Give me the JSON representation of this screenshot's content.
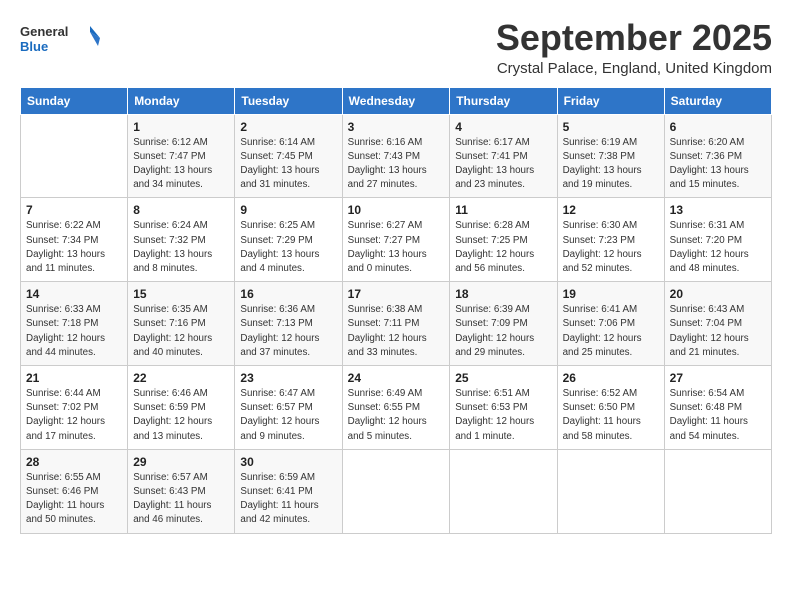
{
  "header": {
    "logo_general": "General",
    "logo_blue": "Blue",
    "month": "September 2025",
    "location": "Crystal Palace, England, United Kingdom"
  },
  "weekdays": [
    "Sunday",
    "Monday",
    "Tuesday",
    "Wednesday",
    "Thursday",
    "Friday",
    "Saturday"
  ],
  "weeks": [
    [
      {
        "day": "",
        "info": ""
      },
      {
        "day": "1",
        "info": "Sunrise: 6:12 AM\nSunset: 7:47 PM\nDaylight: 13 hours\nand 34 minutes."
      },
      {
        "day": "2",
        "info": "Sunrise: 6:14 AM\nSunset: 7:45 PM\nDaylight: 13 hours\nand 31 minutes."
      },
      {
        "day": "3",
        "info": "Sunrise: 6:16 AM\nSunset: 7:43 PM\nDaylight: 13 hours\nand 27 minutes."
      },
      {
        "day": "4",
        "info": "Sunrise: 6:17 AM\nSunset: 7:41 PM\nDaylight: 13 hours\nand 23 minutes."
      },
      {
        "day": "5",
        "info": "Sunrise: 6:19 AM\nSunset: 7:38 PM\nDaylight: 13 hours\nand 19 minutes."
      },
      {
        "day": "6",
        "info": "Sunrise: 6:20 AM\nSunset: 7:36 PM\nDaylight: 13 hours\nand 15 minutes."
      }
    ],
    [
      {
        "day": "7",
        "info": "Sunrise: 6:22 AM\nSunset: 7:34 PM\nDaylight: 13 hours\nand 11 minutes."
      },
      {
        "day": "8",
        "info": "Sunrise: 6:24 AM\nSunset: 7:32 PM\nDaylight: 13 hours\nand 8 minutes."
      },
      {
        "day": "9",
        "info": "Sunrise: 6:25 AM\nSunset: 7:29 PM\nDaylight: 13 hours\nand 4 minutes."
      },
      {
        "day": "10",
        "info": "Sunrise: 6:27 AM\nSunset: 7:27 PM\nDaylight: 13 hours\nand 0 minutes."
      },
      {
        "day": "11",
        "info": "Sunrise: 6:28 AM\nSunset: 7:25 PM\nDaylight: 12 hours\nand 56 minutes."
      },
      {
        "day": "12",
        "info": "Sunrise: 6:30 AM\nSunset: 7:23 PM\nDaylight: 12 hours\nand 52 minutes."
      },
      {
        "day": "13",
        "info": "Sunrise: 6:31 AM\nSunset: 7:20 PM\nDaylight: 12 hours\nand 48 minutes."
      }
    ],
    [
      {
        "day": "14",
        "info": "Sunrise: 6:33 AM\nSunset: 7:18 PM\nDaylight: 12 hours\nand 44 minutes."
      },
      {
        "day": "15",
        "info": "Sunrise: 6:35 AM\nSunset: 7:16 PM\nDaylight: 12 hours\nand 40 minutes."
      },
      {
        "day": "16",
        "info": "Sunrise: 6:36 AM\nSunset: 7:13 PM\nDaylight: 12 hours\nand 37 minutes."
      },
      {
        "day": "17",
        "info": "Sunrise: 6:38 AM\nSunset: 7:11 PM\nDaylight: 12 hours\nand 33 minutes."
      },
      {
        "day": "18",
        "info": "Sunrise: 6:39 AM\nSunset: 7:09 PM\nDaylight: 12 hours\nand 29 minutes."
      },
      {
        "day": "19",
        "info": "Sunrise: 6:41 AM\nSunset: 7:06 PM\nDaylight: 12 hours\nand 25 minutes."
      },
      {
        "day": "20",
        "info": "Sunrise: 6:43 AM\nSunset: 7:04 PM\nDaylight: 12 hours\nand 21 minutes."
      }
    ],
    [
      {
        "day": "21",
        "info": "Sunrise: 6:44 AM\nSunset: 7:02 PM\nDaylight: 12 hours\nand 17 minutes."
      },
      {
        "day": "22",
        "info": "Sunrise: 6:46 AM\nSunset: 6:59 PM\nDaylight: 12 hours\nand 13 minutes."
      },
      {
        "day": "23",
        "info": "Sunrise: 6:47 AM\nSunset: 6:57 PM\nDaylight: 12 hours\nand 9 minutes."
      },
      {
        "day": "24",
        "info": "Sunrise: 6:49 AM\nSunset: 6:55 PM\nDaylight: 12 hours\nand 5 minutes."
      },
      {
        "day": "25",
        "info": "Sunrise: 6:51 AM\nSunset: 6:53 PM\nDaylight: 12 hours\nand 1 minute."
      },
      {
        "day": "26",
        "info": "Sunrise: 6:52 AM\nSunset: 6:50 PM\nDaylight: 11 hours\nand 58 minutes."
      },
      {
        "day": "27",
        "info": "Sunrise: 6:54 AM\nSunset: 6:48 PM\nDaylight: 11 hours\nand 54 minutes."
      }
    ],
    [
      {
        "day": "28",
        "info": "Sunrise: 6:55 AM\nSunset: 6:46 PM\nDaylight: 11 hours\nand 50 minutes."
      },
      {
        "day": "29",
        "info": "Sunrise: 6:57 AM\nSunset: 6:43 PM\nDaylight: 11 hours\nand 46 minutes."
      },
      {
        "day": "30",
        "info": "Sunrise: 6:59 AM\nSunset: 6:41 PM\nDaylight: 11 hours\nand 42 minutes."
      },
      {
        "day": "",
        "info": ""
      },
      {
        "day": "",
        "info": ""
      },
      {
        "day": "",
        "info": ""
      },
      {
        "day": "",
        "info": ""
      }
    ]
  ]
}
